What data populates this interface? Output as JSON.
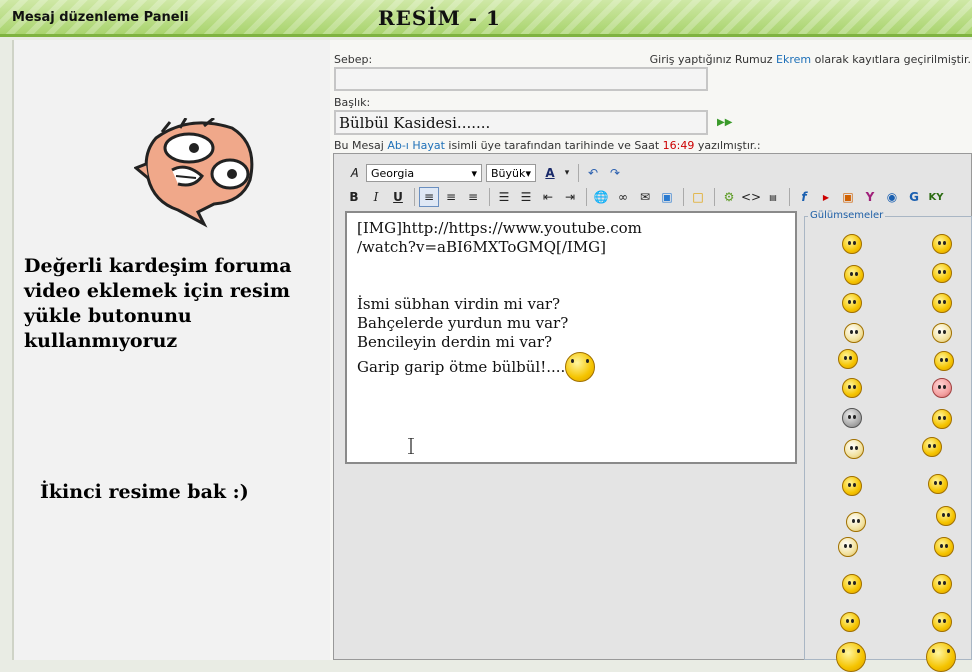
{
  "header": {
    "panel_title": "Mesaj düzenleme Paneli",
    "image_title": "RESİM - 1"
  },
  "left": {
    "message": "Değerli kardeşim foruma video eklemek için resim yükle butonunu kullanmıyoruz",
    "message2": "İkinci resime bak  :)"
  },
  "form": {
    "reason_label": "Sebep:",
    "reason_value": "",
    "title_label": "Başlık:",
    "title_value": "Bülbül Kasidesi.......",
    "login_prefix": "Giriş yaptığınız Rumuz ",
    "login_user": "Ekrem",
    "login_suffix": " olarak kayıtlara geçirilmiştir.",
    "msg_prefix": "Bu Mesaj ",
    "msg_author": "Ab-ı Hayat",
    "msg_mid": " isimli üye tarafından tarihinde ve Saat ",
    "msg_time": "16:49",
    "msg_suffix": " yazılmıştır.:"
  },
  "toolbar": {
    "font": "Georgia",
    "size": "Büyük",
    "bold": "B",
    "italic": "I",
    "underline": "U"
  },
  "editor": {
    "lines": [
      "[IMG]http://https://www.youtube.com",
      "/watch?v=aBI6MXToGMQ[/IMG]",
      "",
      "",
      "İsmi sübhan virdin mi var?",
      "Bahçelerde yurdun mu var?",
      "Bencileyin derdin mi var?",
      "Garip garip ötme bülbül!...."
    ]
  },
  "smilies": {
    "legend": "Gülümsemeler"
  },
  "colors": {
    "header_green": "#a9d46e",
    "link_blue": "#1e70b8",
    "time_red": "#cc0000"
  }
}
